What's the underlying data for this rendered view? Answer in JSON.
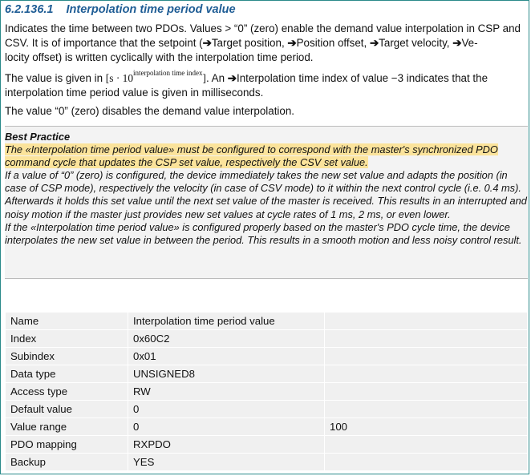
{
  "section": {
    "number": "6.2.136.1",
    "title": "Interpolation time period value"
  },
  "paragraph1": {
    "text_a": "Indicates the time between two PDOs. Values > “0” (zero) enable the demand value interpolation in CSP and CSV. It is of importance that the setpoint (",
    "link1": "Target position, ",
    "link2": "Position offset, ",
    "link3": "Target velocity, ",
    "link4_a": "Ve-",
    "link4_b": "locity offset",
    "text_b": ") is written cyclically with the interpolation time period."
  },
  "paragraph2": {
    "text_a": "The value is given in ",
    "formula_open": "[s · 10",
    "formula_sup": "interpolation time index",
    "formula_close": "]",
    "text_b": ". An ",
    "link": "Interpolation time index",
    "text_c": " of value −3 indicates that the interpolation time period value is given in milliseconds."
  },
  "paragraph3": {
    "text": "The value “0” (zero) disables the demand value interpolation."
  },
  "best_practice": {
    "title": "Best Practice",
    "highlight": "The «Interpolation time period value» must be configured to correspond with the master's synchronized PDO command cycle that updates the CSP set value, respectively the CSV set value.",
    "para1": "If a value of “0” (zero) is configured, the device immediately takes the new set value and adapts the position (in case of CSP mode), respectively the velocity (in case of CSV mode) to it within the next control cycle (i.e. 0.4 ms). Afterwards it holds this set value until the next set value of the master is received. This results in an interrupted and noisy motion if the master just provides new set values at cycle rates of 1 ms, 2 ms, or even lower.",
    "para2": "If the «Interpolation time period value» is configured properly based on the master's PDO cycle time, the device interpolates the new set value in between the period. This results in a smooth motion and less noisy control result."
  },
  "table": {
    "rows": [
      {
        "label": "Name",
        "value": "Interpolation time period value",
        "extra": ""
      },
      {
        "label": "Index",
        "value": "0x60C2",
        "extra": ""
      },
      {
        "label": "Subindex",
        "value": "0x01",
        "extra": ""
      },
      {
        "label": "Data type",
        "value": "UNSIGNED8",
        "extra": ""
      },
      {
        "label": "Access type",
        "value": "RW",
        "extra": ""
      },
      {
        "label": "Default value",
        "value": "0",
        "extra": ""
      },
      {
        "label": "Value range",
        "value": "0",
        "extra": "100"
      },
      {
        "label": "PDO mapping",
        "value": "RXPDO",
        "extra": ""
      },
      {
        "label": "Backup",
        "value": "YES",
        "extra": ""
      }
    ]
  },
  "symbols": {
    "arrow": "➔"
  },
  "colors": {
    "heading": "#1f5d95",
    "highlight": "#fbe39b",
    "table_bg": "#f0f0f0",
    "frame": "#2a8a8a"
  }
}
